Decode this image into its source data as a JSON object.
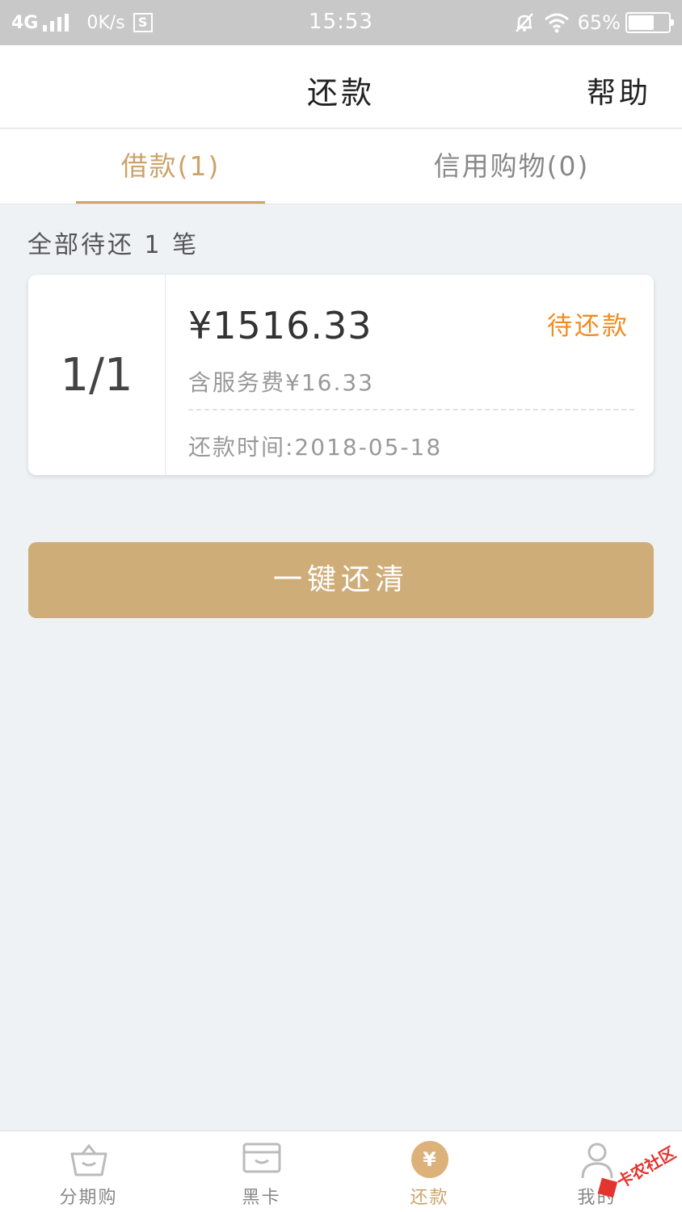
{
  "status_bar": {
    "network": "4G",
    "speed": "0K/s",
    "s_badge": "S",
    "time": "15:53",
    "battery": "65%",
    "battery_level": 0.65
  },
  "header": {
    "title": "还款",
    "help": "帮助"
  },
  "tabs": [
    {
      "label": "借款(1)",
      "active": true
    },
    {
      "label": "信用购物(0)",
      "active": false
    }
  ],
  "summary": "全部待还 1 笔",
  "card": {
    "index": "1/1",
    "amount": "¥1516.33",
    "status": "待还款",
    "fee": "含服务费¥16.33",
    "due": "还款时间:2018-05-18"
  },
  "pay_button": "一键还清",
  "bottom_nav": [
    {
      "label": "分期购",
      "icon": "basket-icon",
      "active": false
    },
    {
      "label": "黑卡",
      "icon": "card-icon",
      "active": false
    },
    {
      "label": "还款",
      "icon": "yen-icon",
      "active": true,
      "glyph": "¥"
    },
    {
      "label": "我的",
      "icon": "person-icon",
      "active": false
    }
  ],
  "watermark": "卡农社区",
  "colors": {
    "accent": "#cca46b",
    "button": "#cfad79",
    "status_orange": "#f08c1e",
    "background": "#eff2f5"
  }
}
